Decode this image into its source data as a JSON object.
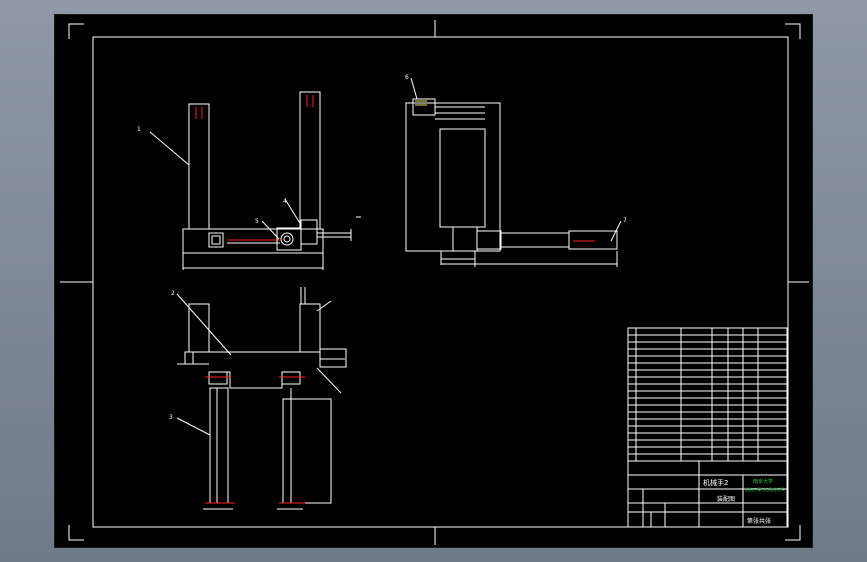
{
  "colors": {
    "background_frame": "#7d8796",
    "sheet": "#000000",
    "line": "#ffffff",
    "accent_red": "#ff2020",
    "accent_green": "#2ec84a",
    "accent_yellow": "#e8e850"
  },
  "balloons": {
    "b1": "1",
    "b2": "2",
    "b3": "3",
    "b4": "4",
    "b5": "5",
    "b6": "6",
    "b7": "7"
  },
  "title_block": {
    "drawing_name": "机械手2",
    "school_line1": "南京大学",
    "school_line2": "机械工程与自动化学院",
    "assembly_label": "装配图",
    "sheet_label": "第张共张"
  }
}
